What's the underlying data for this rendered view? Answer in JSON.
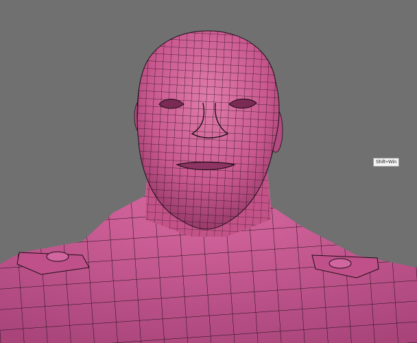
{
  "viewport": {
    "background": "#707070",
    "model_subject": "bust-model",
    "mesh_color": "#c9588f",
    "wire_color": "#1a0d14",
    "display_mode": "polyframe"
  },
  "tooltip": {
    "text": "Shift+Win"
  }
}
